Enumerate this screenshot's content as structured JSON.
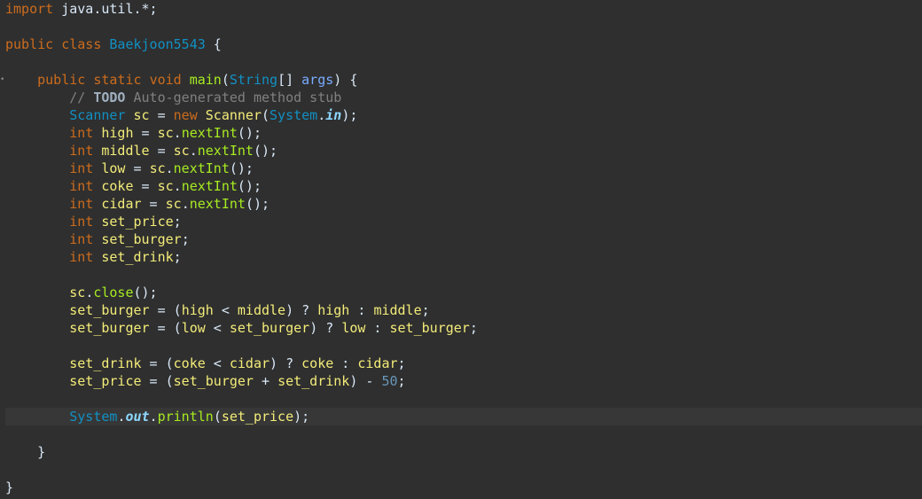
{
  "editor": {
    "lines": [
      [
        {
          "t": "import",
          "c": "kw"
        },
        {
          "t": " java.util.*;",
          "c": "plain"
        }
      ],
      [],
      [
        {
          "t": "public",
          "c": "kw"
        },
        {
          "t": " ",
          "c": "plain"
        },
        {
          "t": "class",
          "c": "kw"
        },
        {
          "t": " ",
          "c": "plain"
        },
        {
          "t": "Baekjoon5543",
          "c": "classname"
        },
        {
          "t": " {",
          "c": "plain"
        }
      ],
      [],
      [
        {
          "t": "    ",
          "c": "plain"
        },
        {
          "t": "public",
          "c": "kw"
        },
        {
          "t": " ",
          "c": "plain"
        },
        {
          "t": "static",
          "c": "kw"
        },
        {
          "t": " ",
          "c": "plain"
        },
        {
          "t": "void",
          "c": "kw"
        },
        {
          "t": " ",
          "c": "plain"
        },
        {
          "t": "main",
          "c": "method"
        },
        {
          "t": "(",
          "c": "plain"
        },
        {
          "t": "String",
          "c": "cls"
        },
        {
          "t": "[] ",
          "c": "plain"
        },
        {
          "t": "args",
          "c": "param"
        },
        {
          "t": ") {",
          "c": "plain"
        }
      ],
      [
        {
          "t": "        ",
          "c": "plain"
        },
        {
          "t": "// ",
          "c": "comment"
        },
        {
          "t": "TODO",
          "c": "todo"
        },
        {
          "t": " Auto-generated method stub",
          "c": "comment"
        }
      ],
      [
        {
          "t": "        ",
          "c": "plain"
        },
        {
          "t": "Scanner",
          "c": "cls"
        },
        {
          "t": " ",
          "c": "plain"
        },
        {
          "t": "sc",
          "c": "var"
        },
        {
          "t": " = ",
          "c": "plain"
        },
        {
          "t": "new",
          "c": "kw"
        },
        {
          "t": " ",
          "c": "plain"
        },
        {
          "t": "Scanner",
          "c": "var"
        },
        {
          "t": "(",
          "c": "plain"
        },
        {
          "t": "System",
          "c": "cls"
        },
        {
          "t": ".",
          "c": "plain"
        },
        {
          "t": "in",
          "c": "static-field"
        },
        {
          "t": ");",
          "c": "plain"
        }
      ],
      [
        {
          "t": "        ",
          "c": "plain"
        },
        {
          "t": "int",
          "c": "kw"
        },
        {
          "t": " ",
          "c": "plain"
        },
        {
          "t": "high",
          "c": "var"
        },
        {
          "t": " = ",
          "c": "plain"
        },
        {
          "t": "sc",
          "c": "var"
        },
        {
          "t": ".",
          "c": "plain"
        },
        {
          "t": "nextInt",
          "c": "method"
        },
        {
          "t": "();",
          "c": "plain"
        }
      ],
      [
        {
          "t": "        ",
          "c": "plain"
        },
        {
          "t": "int",
          "c": "kw"
        },
        {
          "t": " ",
          "c": "plain"
        },
        {
          "t": "middle",
          "c": "var"
        },
        {
          "t": " = ",
          "c": "plain"
        },
        {
          "t": "sc",
          "c": "var"
        },
        {
          "t": ".",
          "c": "plain"
        },
        {
          "t": "nextInt",
          "c": "method"
        },
        {
          "t": "();",
          "c": "plain"
        }
      ],
      [
        {
          "t": "        ",
          "c": "plain"
        },
        {
          "t": "int",
          "c": "kw"
        },
        {
          "t": " ",
          "c": "plain"
        },
        {
          "t": "low",
          "c": "var"
        },
        {
          "t": " = ",
          "c": "plain"
        },
        {
          "t": "sc",
          "c": "var"
        },
        {
          "t": ".",
          "c": "plain"
        },
        {
          "t": "nextInt",
          "c": "method"
        },
        {
          "t": "();",
          "c": "plain"
        }
      ],
      [
        {
          "t": "        ",
          "c": "plain"
        },
        {
          "t": "int",
          "c": "kw"
        },
        {
          "t": " ",
          "c": "plain"
        },
        {
          "t": "coke",
          "c": "var"
        },
        {
          "t": " = ",
          "c": "plain"
        },
        {
          "t": "sc",
          "c": "var"
        },
        {
          "t": ".",
          "c": "plain"
        },
        {
          "t": "nextInt",
          "c": "method"
        },
        {
          "t": "();",
          "c": "plain"
        }
      ],
      [
        {
          "t": "        ",
          "c": "plain"
        },
        {
          "t": "int",
          "c": "kw"
        },
        {
          "t": " ",
          "c": "plain"
        },
        {
          "t": "cidar",
          "c": "var"
        },
        {
          "t": " = ",
          "c": "plain"
        },
        {
          "t": "sc",
          "c": "var"
        },
        {
          "t": ".",
          "c": "plain"
        },
        {
          "t": "nextInt",
          "c": "method"
        },
        {
          "t": "();",
          "c": "plain"
        }
      ],
      [
        {
          "t": "        ",
          "c": "plain"
        },
        {
          "t": "int",
          "c": "kw"
        },
        {
          "t": " ",
          "c": "plain"
        },
        {
          "t": "set_price",
          "c": "var"
        },
        {
          "t": ";",
          "c": "plain"
        }
      ],
      [
        {
          "t": "        ",
          "c": "plain"
        },
        {
          "t": "int",
          "c": "kw"
        },
        {
          "t": " ",
          "c": "plain"
        },
        {
          "t": "set_burger",
          "c": "var"
        },
        {
          "t": ";",
          "c": "plain"
        }
      ],
      [
        {
          "t": "        ",
          "c": "plain"
        },
        {
          "t": "int",
          "c": "kw"
        },
        {
          "t": " ",
          "c": "plain"
        },
        {
          "t": "set_drink",
          "c": "var"
        },
        {
          "t": ";",
          "c": "plain"
        }
      ],
      [],
      [
        {
          "t": "        ",
          "c": "plain"
        },
        {
          "t": "sc",
          "c": "var"
        },
        {
          "t": ".",
          "c": "plain"
        },
        {
          "t": "close",
          "c": "method"
        },
        {
          "t": "();",
          "c": "plain"
        }
      ],
      [
        {
          "t": "        ",
          "c": "plain"
        },
        {
          "t": "set_burger",
          "c": "var"
        },
        {
          "t": " = (",
          "c": "plain"
        },
        {
          "t": "high",
          "c": "var"
        },
        {
          "t": " < ",
          "c": "plain"
        },
        {
          "t": "middle",
          "c": "var"
        },
        {
          "t": ") ? ",
          "c": "plain"
        },
        {
          "t": "high",
          "c": "var"
        },
        {
          "t": " : ",
          "c": "plain"
        },
        {
          "t": "middle",
          "c": "var"
        },
        {
          "t": ";",
          "c": "plain"
        }
      ],
      [
        {
          "t": "        ",
          "c": "plain"
        },
        {
          "t": "set_burger",
          "c": "var"
        },
        {
          "t": " = (",
          "c": "plain"
        },
        {
          "t": "low",
          "c": "var"
        },
        {
          "t": " < ",
          "c": "plain"
        },
        {
          "t": "set_burger",
          "c": "var"
        },
        {
          "t": ") ? ",
          "c": "plain"
        },
        {
          "t": "low",
          "c": "var"
        },
        {
          "t": " : ",
          "c": "plain"
        },
        {
          "t": "set_burger",
          "c": "var"
        },
        {
          "t": ";",
          "c": "plain"
        }
      ],
      [],
      [
        {
          "t": "        ",
          "c": "plain"
        },
        {
          "t": "set_drink",
          "c": "var"
        },
        {
          "t": " = (",
          "c": "plain"
        },
        {
          "t": "coke",
          "c": "var"
        },
        {
          "t": " < ",
          "c": "plain"
        },
        {
          "t": "cidar",
          "c": "var"
        },
        {
          "t": ") ? ",
          "c": "plain"
        },
        {
          "t": "coke",
          "c": "var"
        },
        {
          "t": " : ",
          "c": "plain"
        },
        {
          "t": "cidar",
          "c": "var"
        },
        {
          "t": ";",
          "c": "plain"
        }
      ],
      [
        {
          "t": "        ",
          "c": "plain"
        },
        {
          "t": "set_price",
          "c": "var"
        },
        {
          "t": " = (",
          "c": "plain"
        },
        {
          "t": "set_burger",
          "c": "var"
        },
        {
          "t": " + ",
          "c": "plain"
        },
        {
          "t": "set_drink",
          "c": "var"
        },
        {
          "t": ") - ",
          "c": "plain"
        },
        {
          "t": "50",
          "c": "num"
        },
        {
          "t": ";",
          "c": "plain"
        }
      ],
      [],
      [
        {
          "t": "        ",
          "c": "plain"
        },
        {
          "t": "System",
          "c": "cls"
        },
        {
          "t": ".",
          "c": "plain"
        },
        {
          "t": "out",
          "c": "static-field"
        },
        {
          "t": ".",
          "c": "plain"
        },
        {
          "t": "println",
          "c": "method"
        },
        {
          "t": "(",
          "c": "plain"
        },
        {
          "t": "set_price",
          "c": "var"
        },
        {
          "t": ");",
          "c": "plain"
        }
      ],
      [],
      [
        {
          "t": "    }",
          "c": "plain"
        }
      ],
      [],
      [
        {
          "t": "}",
          "c": "plain"
        }
      ]
    ],
    "current_line_index": 23,
    "fold_marker_icon": "fold-collapse-icon",
    "colors": {
      "background": "#2f2f2f",
      "current_line": "#373737",
      "keyword": "#cc6c1d",
      "type": "#1290c3",
      "method": "#a7ec21",
      "variable": "#f3ec79",
      "parameter": "#79abff",
      "comment": "#808080",
      "number": "#6897bb",
      "static_field": "#8dd8ff"
    }
  }
}
